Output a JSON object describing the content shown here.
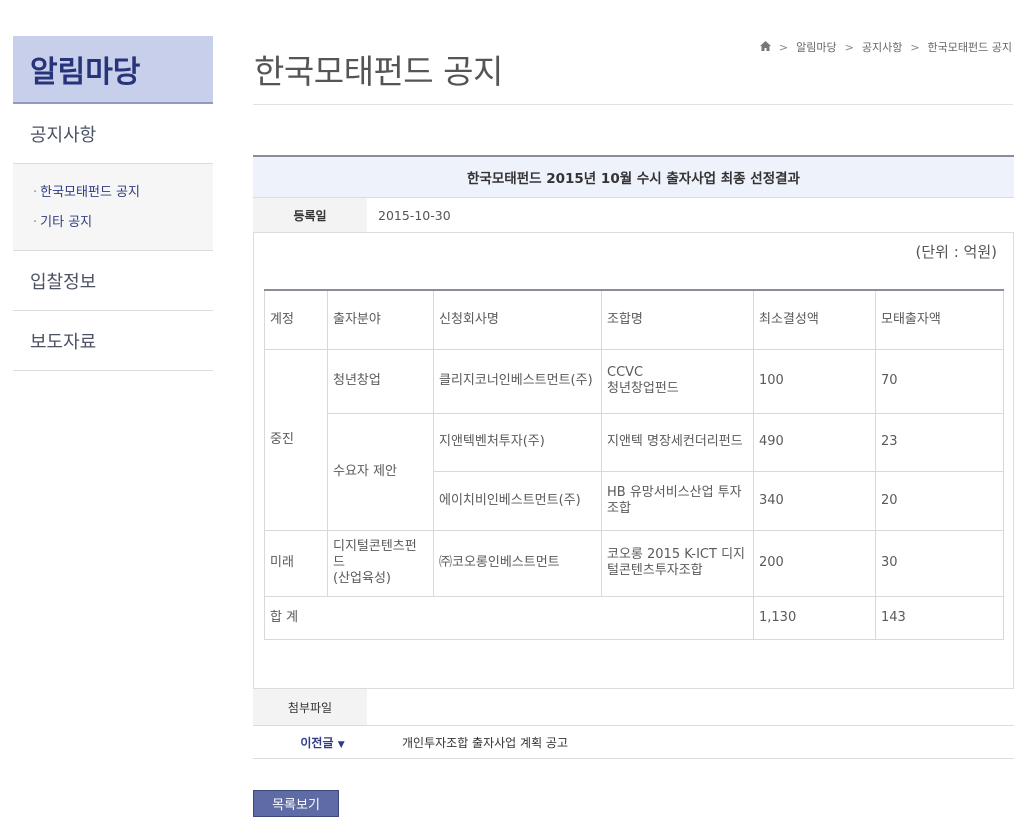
{
  "sidebar": {
    "title": "알림마당",
    "menu": [
      {
        "label": "공지사항"
      },
      {
        "label": "입찰정보"
      },
      {
        "label": "보도자료"
      }
    ],
    "submenu": [
      {
        "label": "한국모태펀드 공지"
      },
      {
        "label": "기타 공지"
      }
    ]
  },
  "header": {
    "title": "한국모태펀드 공지",
    "breadcrumb": [
      "알림마당",
      "공지사항",
      "한국모태펀드 공지"
    ],
    "home_icon": "home-icon"
  },
  "notice": {
    "title": "한국모태펀드 2015년 10월 수시 출자사업 최종 선정결과",
    "date_label": "등록일",
    "date": "2015-10-30",
    "unit": "(단위 : 억원)"
  },
  "table": {
    "headers": [
      "계정",
      "출자분야",
      "신청회사명",
      "조합명",
      "최소결성액",
      "모태출자액"
    ],
    "account_1": "중진",
    "account_2": "미래",
    "field_1": "청년창업",
    "field_2": "수요자 제안",
    "field_3_line1": "디지털콘텐츠펀드",
    "field_3_line2": "(산업육성)",
    "rows": [
      {
        "company": "클리지코너인베스트먼트(주)",
        "fund_line1": "CCVC",
        "fund_line2": "청년창업펀드",
        "min": "100",
        "mother": "70"
      },
      {
        "company": "지앤텍벤처투자(주)",
        "fund": "지앤텍 명장세컨더리펀드",
        "min": "490",
        "mother": "23"
      },
      {
        "company": "에이치비인베스트먼트(주)",
        "fund": "HB 유망서비스산업 투자조합",
        "min": "340",
        "mother": "20"
      },
      {
        "company": "㈜코오롱인베스트먼트",
        "fund": "코오롱 2015 K-ICT 디지털콘텐츠투자조합",
        "min": "200",
        "mother": "30"
      }
    ],
    "total_label": "합 계",
    "total_min": "1,130",
    "total_mother": "143"
  },
  "attachment": {
    "label": "첨부파일"
  },
  "prev": {
    "label": "이전글",
    "arrow": "▼",
    "title": "개인투자조합 출자사업 계획 공고"
  },
  "list_button": "목록보기"
}
